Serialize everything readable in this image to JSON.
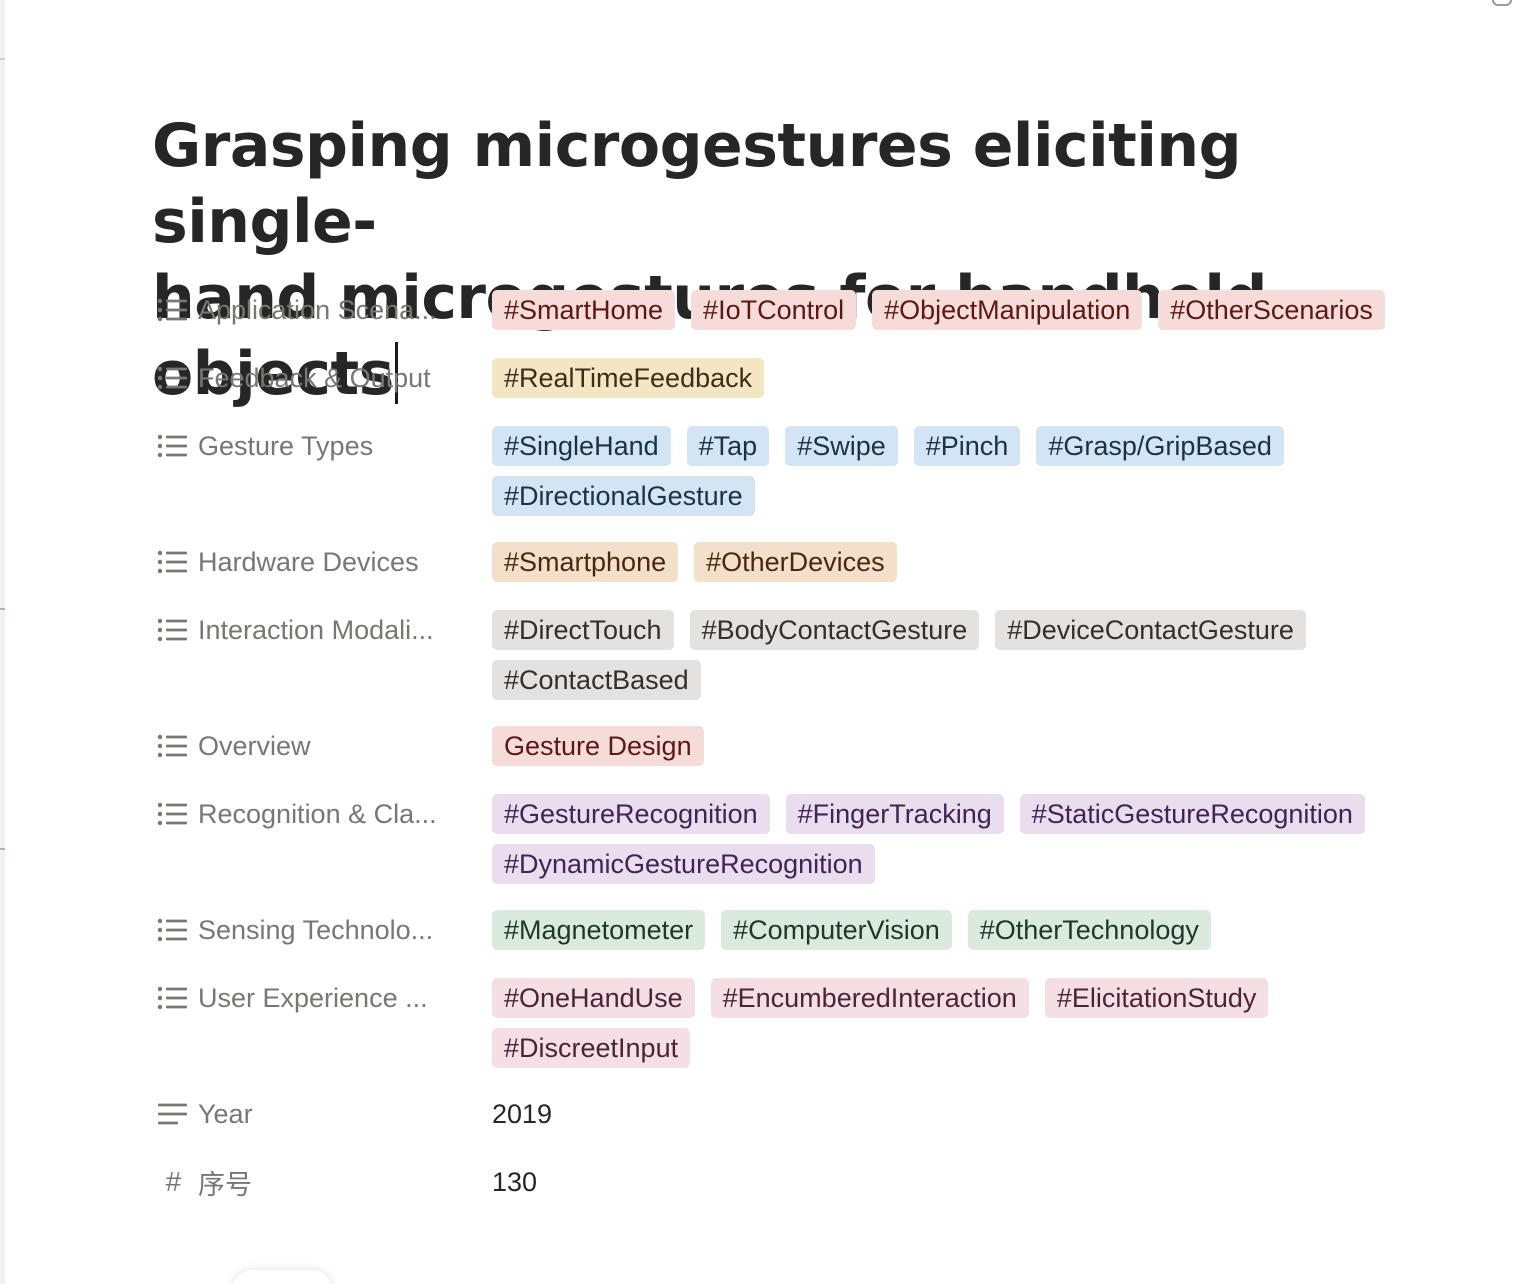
{
  "page": {
    "title_line1": "Grasping microgestures eliciting single-",
    "title_line2": "hand microgestures for handheld objects"
  },
  "properties": [
    {
      "label": "Application Scena...",
      "icon": "list-icon",
      "color": "red",
      "tags": [
        "#SmartHome",
        "#IoTControl",
        "#ObjectManipulation",
        "#OtherScenarios"
      ]
    },
    {
      "label": "Feedback & Output",
      "icon": "list-icon",
      "color": "yellow",
      "tags": [
        "#RealTimeFeedback"
      ]
    },
    {
      "label": "Gesture Types",
      "icon": "list-icon",
      "color": "blue",
      "tags": [
        "#SingleHand",
        "#Tap",
        "#Swipe",
        "#Pinch",
        "#Grasp/GripBased",
        "#DirectionalGesture"
      ]
    },
    {
      "label": "Hardware Devices",
      "icon": "list-icon",
      "color": "orange",
      "tags": [
        "#Smartphone",
        "#OtherDevices"
      ]
    },
    {
      "label": "Interaction Modali...",
      "icon": "list-icon",
      "color": "gray",
      "tags": [
        "#DirectTouch",
        "#BodyContactGesture",
        "#DeviceContactGesture",
        "#ContactBased"
      ]
    },
    {
      "label": "Overview",
      "icon": "list-icon",
      "color": "red",
      "tags": [
        "Gesture Design"
      ]
    },
    {
      "label": "Recognition & Cla...",
      "icon": "list-icon",
      "color": "purple",
      "tags": [
        "#GestureRecognition",
        "#FingerTracking",
        "#StaticGestureRecognition",
        "#DynamicGestureRecognition"
      ]
    },
    {
      "label": "Sensing Technolo...",
      "icon": "list-icon",
      "color": "green",
      "tags": [
        "#Magnetometer",
        "#ComputerVision",
        "#OtherTechnology"
      ]
    },
    {
      "label": "User Experience ...",
      "icon": "list-icon",
      "color": "pink",
      "tags": [
        "#OneHandUse",
        "#EncumberedInteraction",
        "#ElicitationStudy",
        "#DiscreetInput"
      ]
    },
    {
      "label": "Year",
      "icon": "text-icon",
      "value": "2019"
    },
    {
      "label": "序号",
      "icon": "hash-icon",
      "value": "130"
    }
  ],
  "colors": {
    "red": "#f6dcd9",
    "yellow": "#f3e6c2",
    "blue": "#d3e4f4",
    "orange": "#f4dfcb",
    "gray": "#e3e2e0",
    "purple": "#e8deee",
    "green": "#dbeadf",
    "pink": "#f4dfe5"
  }
}
